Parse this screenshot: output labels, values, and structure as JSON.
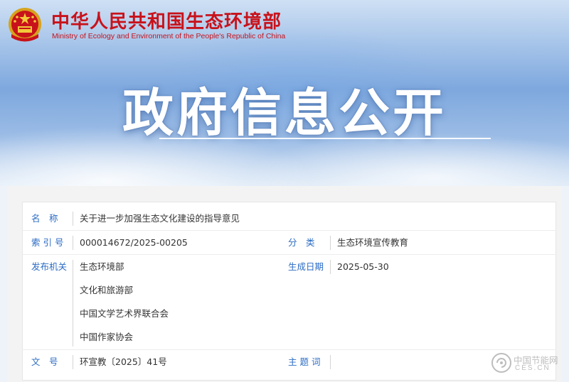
{
  "header": {
    "ministry_cn": "中华人民共和国生态环境部",
    "ministry_en": "Ministry of Ecology and Environment of the People's Republic of China",
    "emblem_icon": "national-emblem-icon",
    "banner_title": "政府信息公开"
  },
  "info": {
    "name_label": "名　称",
    "name_value": "关于进一步加强生态文化建设的指导意见",
    "index_label": "索 引 号",
    "index_value": "000014672/2025-00205",
    "category_label": "分　类",
    "category_value": "生态环境宣传教育",
    "issuer_label": "发布机关",
    "issuers": [
      "生态环境部",
      "文化和旅游部",
      "中国文学艺术界联合会",
      "中国作家协会"
    ],
    "date_label": "生成日期",
    "date_value": "2025-05-30",
    "docno_label": "文　号",
    "docno_value": "环宣教〔2025〕41号",
    "keywords_label": "主 题 词",
    "keywords_value": ""
  },
  "watermark": {
    "cn": "中国节能网",
    "en": "CES.CN"
  },
  "colors": {
    "brand_red": "#c8121b",
    "label_blue": "#2b6cc4"
  }
}
